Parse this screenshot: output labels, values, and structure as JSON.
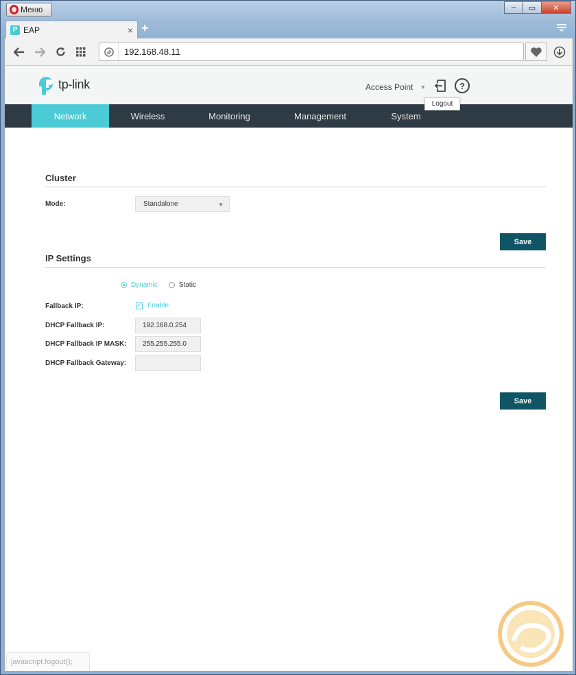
{
  "browser": {
    "menu_label": "Меню",
    "tab_title": "EAP",
    "tab_favicon": "P",
    "new_tab_icon": "+",
    "close_tab_icon": "×",
    "address": "192.168.48.11",
    "status_text": "javascript:logout();",
    "window_controls": {
      "minimize": "–",
      "maximize": "▭",
      "close": "✕"
    }
  },
  "header": {
    "logo_text": "tp-link",
    "mode_value": "Access Point",
    "logout_tooltip": "Logout",
    "help_symbol": "?"
  },
  "nav": {
    "items": [
      {
        "label": "Network",
        "active": true
      },
      {
        "label": "Wireless",
        "active": false
      },
      {
        "label": "Monitoring",
        "active": false
      },
      {
        "label": "Management",
        "active": false
      },
      {
        "label": "System",
        "active": false
      }
    ]
  },
  "cluster": {
    "title": "Cluster",
    "mode_label": "Mode:",
    "mode_value": "Standalone",
    "save_label": "Save"
  },
  "ip_settings": {
    "title": "IP Settings",
    "radio_dynamic": "Dynamic",
    "radio_static": "Static",
    "fallback_ip_label": "Fallback IP:",
    "fallback_enable_label": "Enable",
    "dhcp_fallback_ip_label": "DHCP Fallback IP:",
    "dhcp_fallback_ip_value": "192.168.0.254",
    "dhcp_fallback_mask_label": "DHCP Fallback IP MASK:",
    "dhcp_fallback_mask_value": "255.255.255.0",
    "dhcp_fallback_gateway_label": "DHCP Fallback Gateway:",
    "dhcp_fallback_gateway_value": "",
    "save_label": "Save"
  },
  "colors": {
    "accent": "#4acbd6",
    "nav_bg": "#2f3b44",
    "button_bg": "#0f5566"
  }
}
